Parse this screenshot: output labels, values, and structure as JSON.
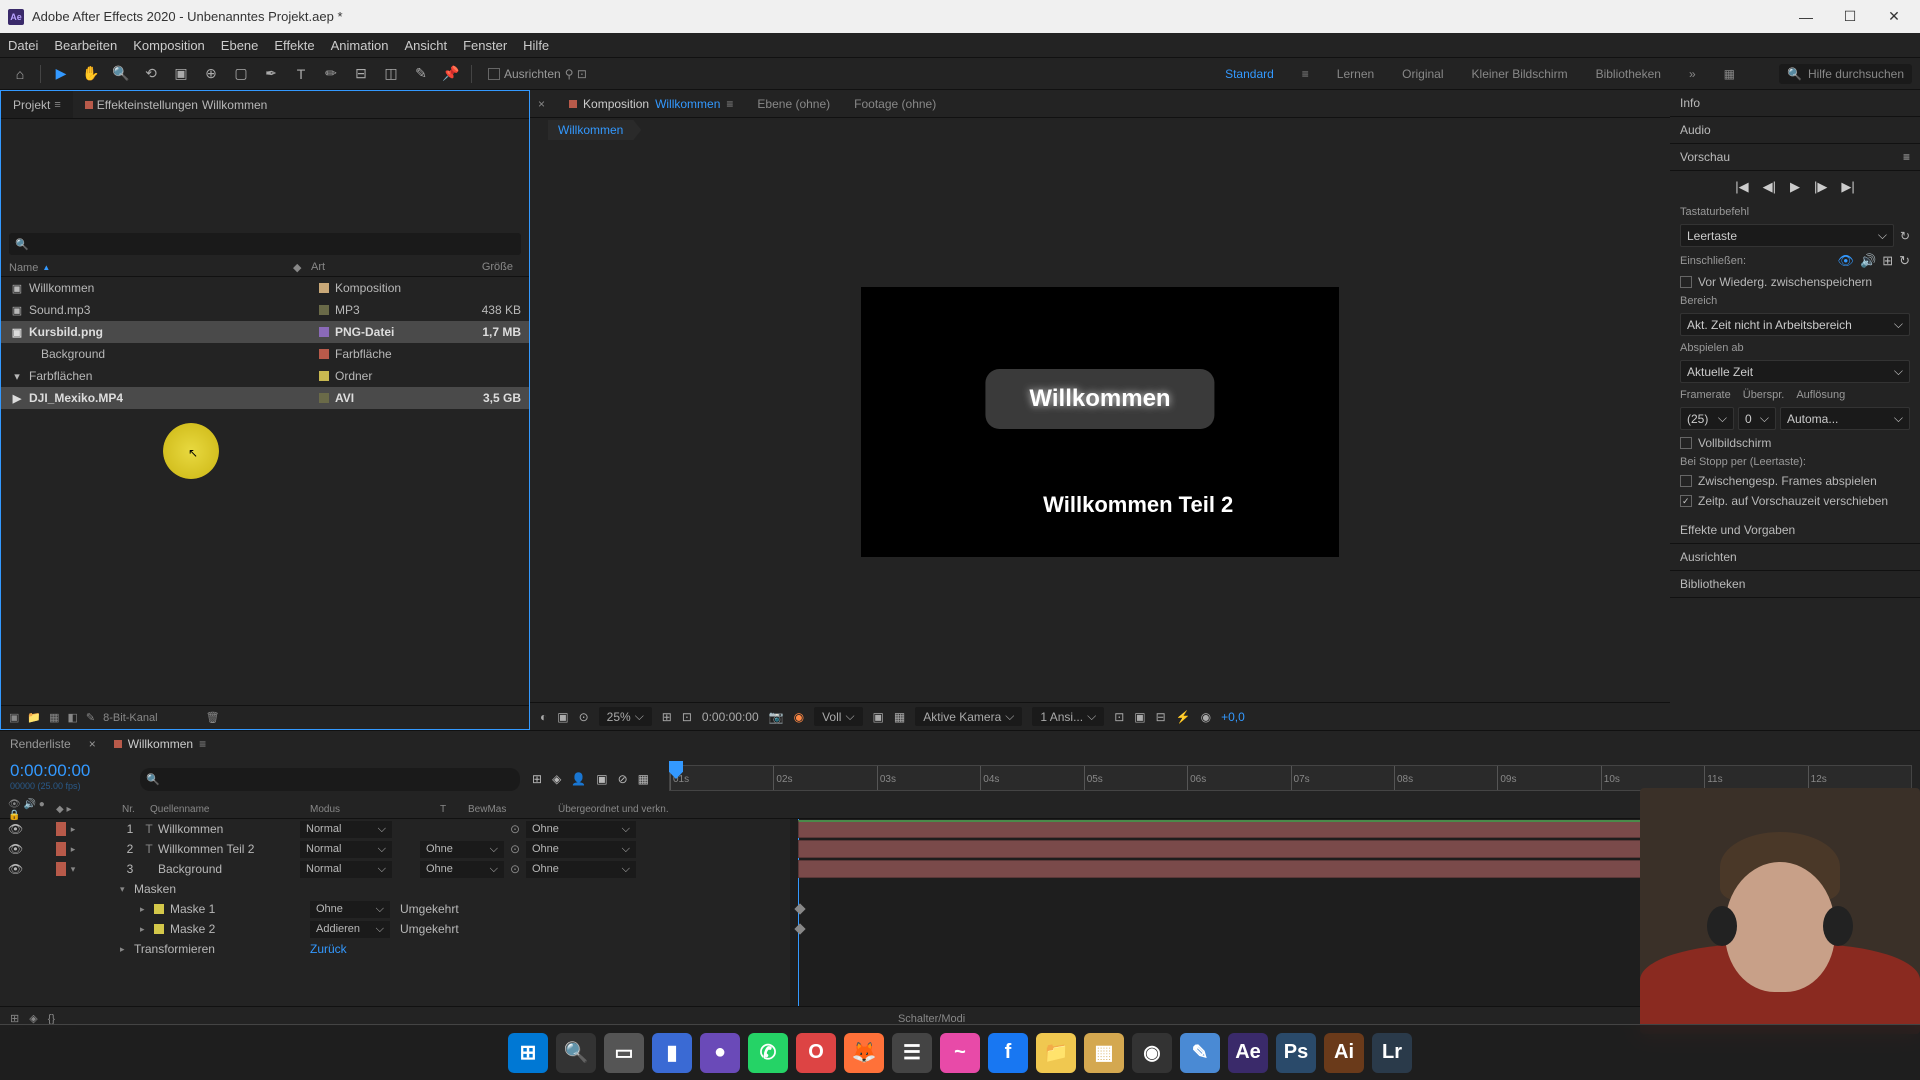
{
  "titlebar": {
    "app_prefix": "Ae",
    "title": "Adobe After Effects 2020 - Unbenanntes Projekt.aep *"
  },
  "menu": [
    "Datei",
    "Bearbeiten",
    "Komposition",
    "Ebene",
    "Effekte",
    "Animation",
    "Ansicht",
    "Fenster",
    "Hilfe"
  ],
  "toolbar": {
    "ausrichten": "Ausrichten"
  },
  "workspaces": {
    "items": [
      "Standard",
      "Lernen",
      "Original",
      "Kleiner Bildschirm",
      "Bibliotheken"
    ],
    "active": "Standard",
    "search_placeholder": "Hilfe durchsuchen"
  },
  "project": {
    "tab": "Projekt",
    "effects_tab_prefix": "Effekteinstellungen",
    "effects_tab_comp": "Willkommen",
    "cols": {
      "name": "Name",
      "art": "Art",
      "size": "Größe"
    },
    "rows": [
      {
        "name": "DJI_Mexiko.MP4",
        "art": "AVI",
        "size": "3,5 GB",
        "icon": "▶",
        "bold": true,
        "sel": true,
        "ind": 0,
        "swatch": "#6a6a48"
      },
      {
        "name": "Farbflächen",
        "art": "Ordner",
        "size": "",
        "icon": "▾",
        "bold": false,
        "sel": false,
        "ind": 0,
        "swatch": "#c8b850"
      },
      {
        "name": "Background",
        "art": "Farbfläche",
        "size": "",
        "icon": "",
        "bold": false,
        "sel": false,
        "ind": 1,
        "swatch": "#b85a4a"
      },
      {
        "name": "Kursbild.png",
        "art": "PNG-Datei",
        "size": "1,7 MB",
        "icon": "▣",
        "bold": true,
        "sel": true,
        "ind": 0,
        "swatch": "#8a6ab8"
      },
      {
        "name": "Sound.mp3",
        "art": "MP3",
        "size": "438 KB",
        "icon": "▣",
        "bold": false,
        "sel": false,
        "ind": 0,
        "swatch": "#6a6a48"
      },
      {
        "name": "Willkommen",
        "art": "Komposition",
        "size": "",
        "icon": "▣",
        "bold": false,
        "sel": false,
        "ind": 0,
        "swatch": "#c8a878"
      }
    ],
    "footer_depth": "8-Bit-Kanal"
  },
  "comp": {
    "tab_label": "Komposition",
    "tab_name": "Willkommen",
    "ebene": "Ebene (ohne)",
    "footage": "Footage (ohne)",
    "breadcrumb": "Willkommen",
    "text1": "Willkommen",
    "text2": "Willkommen Teil 2",
    "footer": {
      "zoom": "25%",
      "time": "0:00:00:00",
      "res": "Voll",
      "camera": "Aktive Kamera",
      "views": "1 Ansi...",
      "exp": "+0,0"
    }
  },
  "right": {
    "info": "Info",
    "audio": "Audio",
    "vorschau": "Vorschau",
    "tastatur_l": "Tastaturbefehl",
    "tastatur_v": "Leertaste",
    "einschl": "Einschließen:",
    "wiederg": "Vor Wiederg. zwischenspeichern",
    "bereich_l": "Bereich",
    "bereich_v": "Akt. Zeit nicht in Arbeitsbereich",
    "abspielen_l": "Abspielen ab",
    "abspielen_v": "Aktuelle Zeit",
    "framerate_l": "Framerate",
    "uberspr_l": "Überspr.",
    "aufl_l": "Auflösung",
    "framerate_v": "(25)",
    "uberspr_v": "0",
    "aufl_v": "Automa...",
    "vollbild": "Vollbildschirm",
    "beistopp": "Bei Stopp per (Leertaste):",
    "zwframes": "Zwischengesp. Frames abspielen",
    "zeitp": "Zeitp. auf Vorschauzeit verschieben",
    "effekte": "Effekte und Vorgaben",
    "ausrichten": "Ausrichten",
    "biblio": "Bibliotheken"
  },
  "timeline": {
    "render_tab": "Renderliste",
    "comp_tab": "Willkommen",
    "timecode": "0:00:00:00",
    "timecode_sub": "00000 (25.00 fps)",
    "cols": {
      "nr": "Nr.",
      "name": "Quellenname",
      "mode": "Modus",
      "t": "T",
      "bew": "BewMas",
      "parent": "Übergeordnet und verkn."
    },
    "ruler": [
      "01s",
      "02s",
      "03s",
      "04s",
      "05s",
      "06s",
      "07s",
      "08s",
      "09s",
      "10s",
      "11s",
      "12s"
    ],
    "layers": [
      {
        "nr": "1",
        "icon": "T",
        "name": "Willkommen",
        "mode": "Normal",
        "bew": "",
        "parent": "Ohne",
        "sw": "#b85a4a",
        "open": false
      },
      {
        "nr": "2",
        "icon": "T",
        "name": "Willkommen Teil 2",
        "mode": "Normal",
        "bew": "Ohne",
        "parent": "Ohne",
        "sw": "#b85a4a",
        "open": false
      },
      {
        "nr": "3",
        "icon": "",
        "name": "Background",
        "mode": "Normal",
        "bew": "Ohne",
        "parent": "Ohne",
        "sw": "#b85a4a",
        "open": true
      }
    ],
    "masken": "Masken",
    "masks": [
      {
        "name": "Maske 1",
        "mode": "Ohne",
        "inv": "Umgekehrt"
      },
      {
        "name": "Maske 2",
        "mode": "Addieren",
        "inv": "Umgekehrt"
      }
    ],
    "transform": "Transformieren",
    "transform_v": "Zurück",
    "footer": "Schalter/Modi"
  },
  "taskbar": [
    {
      "bg": "#0078d4",
      "t": "⊞"
    },
    {
      "bg": "#333",
      "t": "🔍"
    },
    {
      "bg": "#555",
      "t": "▭"
    },
    {
      "bg": "#3a6ad4",
      "t": "▮"
    },
    {
      "bg": "#6a4ab8",
      "t": "●"
    },
    {
      "bg": "#25d366",
      "t": "✆"
    },
    {
      "bg": "#d44",
      "t": "O"
    },
    {
      "bg": "#ff7139",
      "t": "🦊"
    },
    {
      "bg": "#444",
      "t": "☰"
    },
    {
      "bg": "#e84aa8",
      "t": "~"
    },
    {
      "bg": "#1877f2",
      "t": "f"
    },
    {
      "bg": "#f0c850",
      "t": "📁"
    },
    {
      "bg": "#d4a850",
      "t": "▦"
    },
    {
      "bg": "#333",
      "t": "◉"
    },
    {
      "bg": "#4a8ad4",
      "t": "✎"
    },
    {
      "bg": "#3a2a6a",
      "t": "Ae"
    },
    {
      "bg": "#2a4a6a",
      "t": "Ps"
    },
    {
      "bg": "#6a3a1a",
      "t": "Ai"
    },
    {
      "bg": "#2a3a4a",
      "t": "Lr"
    }
  ]
}
